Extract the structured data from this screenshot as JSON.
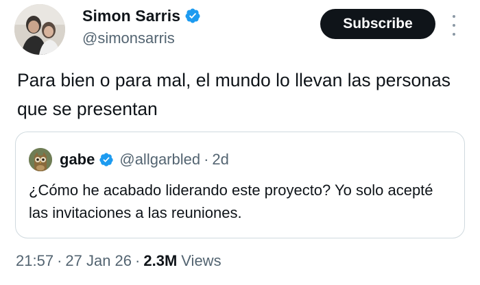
{
  "author": {
    "display_name": "Simon Sarris",
    "handle": "@simonsarris",
    "verified": true
  },
  "header": {
    "subscribe_label": "Subscribe",
    "more_icon": "more-vertical-icon"
  },
  "tweet": {
    "text": "Para bien o para mal, el mundo lo llevan las personas que se presentan"
  },
  "quoted_tweet": {
    "display_name": "gabe",
    "handle": "@allgarbled",
    "separator": "·",
    "time": "2d",
    "verified": true,
    "text": "¿Cómo he acabado liderando este proyecto? Yo solo acepté las invitaciones a las reuniones."
  },
  "meta": {
    "time": "21:57",
    "separator": "·",
    "date": "27 Jan 26",
    "views_count": "2.3M",
    "views_label": "Views"
  },
  "colors": {
    "verified_blue": "#1d9bf0",
    "text_primary": "#0f1419",
    "text_secondary": "#536471",
    "border": "#cfd9de",
    "button_bg": "#0f1419"
  }
}
